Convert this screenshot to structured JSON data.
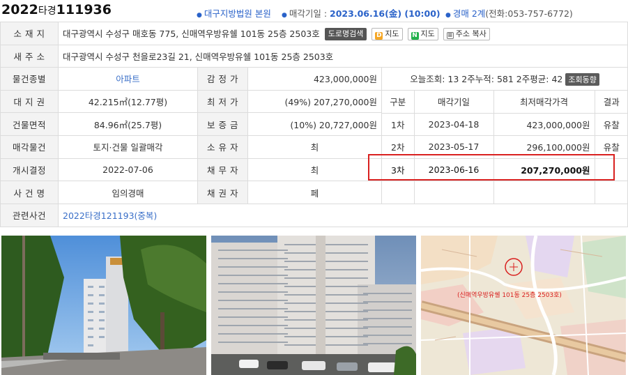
{
  "header": {
    "case_year": "2022",
    "case_kind": "타경",
    "case_number": "111936",
    "court": "대구지방법원 본원",
    "sale_date_label": "매각기일 :",
    "sale_date": "2023.06.16(金) (10:00)",
    "division": "경매 2계",
    "phone": "(전화:053-757-6772)"
  },
  "address": {
    "label": "소 재 지",
    "value": "대구광역시 수성구 매호동 775, 신매역우방유쉘 101동 25층 2503호",
    "btn_road": "도로명검색",
    "btn_daum_map": "지도",
    "btn_naver_map": "지도",
    "btn_copy": "주소 복사"
  },
  "new_address": {
    "label": "새 주 소",
    "value": "대구광역시 수성구 천을로23길 21, 신매역우방유쉘 101동 25층 2503호"
  },
  "rows": {
    "type_label": "물건종별",
    "type_value": "아파트",
    "appraisal_label": "감 정 가",
    "appraisal_value": "423,000,000원",
    "land_label": "대 지 권",
    "land_value": "42.215㎡(12.77평)",
    "min_label": "최 저 가",
    "min_value": "(49%) 207,270,000원",
    "building_label": "건물면적",
    "building_value": "84.96㎡(25.7평)",
    "deposit_label": "보 증 금",
    "deposit_value": "(10%) 20,727,000원",
    "sale_obj_label": "매각물건",
    "sale_obj_value": "토지·건물 일괄매각",
    "owner_label": "소 유 자",
    "owner_value": "최",
    "start_label": "개시결정",
    "start_value": "2022-07-06",
    "debtor_label": "채 무 자",
    "debtor_value": "최",
    "case_name_label": "사 건 명",
    "case_name_value": "임의경매",
    "creditor_label": "채 권 자",
    "creditor_value": "페",
    "related_label": "관련사건",
    "related_value": "2022타경121193(중복)"
  },
  "views": {
    "today_label": "오늘조회:",
    "today_value": "13",
    "two_week_label": "2주누적:",
    "two_week_value": "581",
    "two_week_avg_label": "2주평균:",
    "two_week_avg_value": "42",
    "trend_button": "조회동향"
  },
  "history": {
    "headers": [
      "구분",
      "매각기일",
      "최저매각가격",
      "결과"
    ],
    "rows": [
      {
        "round": "1차",
        "date": "2023-04-18",
        "price": "423,000,000원",
        "result": "유찰"
      },
      {
        "round": "2차",
        "date": "2023-05-17",
        "price": "296,100,000원",
        "result": "유찰"
      },
      {
        "round": "3차",
        "date": "2023-06-16",
        "price": "207,270,000원",
        "result": ""
      }
    ]
  },
  "map": {
    "label": "(신매역우방유쉘 101동 25층 2503호)"
  },
  "colors": {
    "accent_blue": "#2a62c9",
    "highlight_red": "#d9201f",
    "label_bg": "#f3f3f3"
  }
}
